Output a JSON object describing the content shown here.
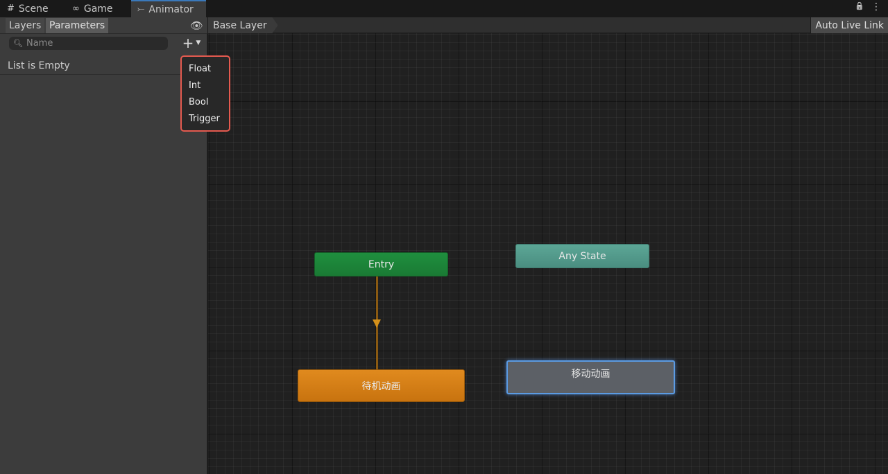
{
  "tabs": [
    {
      "icon": "#",
      "label": "Scene"
    },
    {
      "icon": "∞",
      "label": "Game"
    },
    {
      "icon": "⤚",
      "label": "Animator"
    }
  ],
  "top_right": {
    "lock": "🔒",
    "more": "⋮"
  },
  "left_panel": {
    "subtabs": {
      "layers": "Layers",
      "parameters": "Parameters"
    },
    "search_placeholder": "Name",
    "add_button": "+",
    "empty_text": "List is Empty"
  },
  "add_menu": {
    "items": [
      "Float",
      "Int",
      "Bool",
      "Trigger"
    ],
    "highlight_color": "#e55a4f"
  },
  "graph": {
    "breadcrumb": "Base Layer",
    "auto_live_link": "Auto Live Link",
    "nodes": {
      "entry": "Entry",
      "any_state": "Any State",
      "idle": "待机动画",
      "move": "移动动画"
    }
  }
}
